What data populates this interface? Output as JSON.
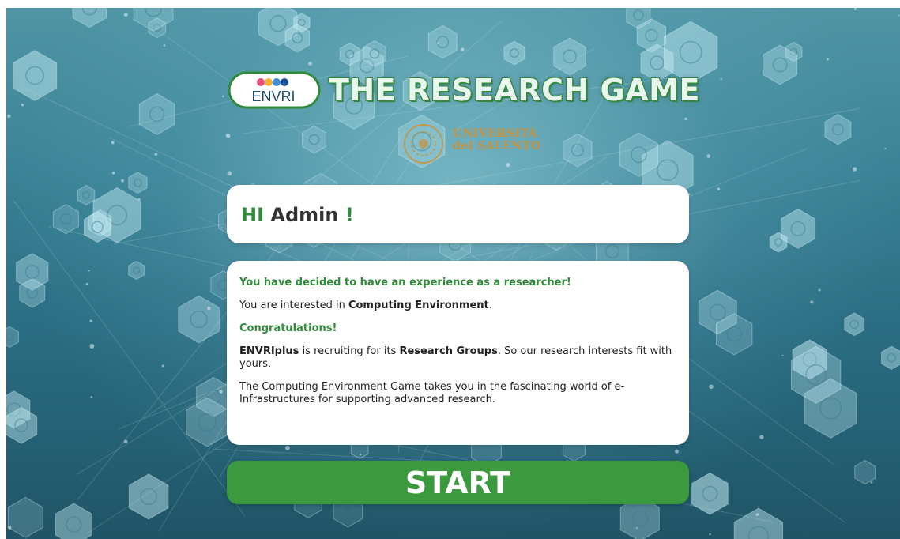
{
  "header": {
    "logo_text": "ENVRI",
    "title": "THE RESEARCH GAME"
  },
  "university": {
    "name_line1": "UNIVERSITÀ",
    "name_line2": "del SALENTO"
  },
  "greeting": {
    "hi": "HI",
    "name": "Admin",
    "exclaim": "!"
  },
  "message": {
    "line1": "You have decided to have an experience as a researcher!",
    "line2_prefix": "You are interested in ",
    "line2_topic": "Computing Environment",
    "line2_suffix": ".",
    "line3": "Congratulations!",
    "line4_org": "ENVRIplus",
    "line4_mid": " is recruiting for its ",
    "line4_groups": "Research Groups",
    "line4_suffix": ". So our research interests fit with yours.",
    "line5": "The Computing Environment Game takes you in the fascinating world of e-Infrastructures for supporting advanced research."
  },
  "start_button": {
    "label": "START"
  },
  "colors": {
    "accent_green": "#2f8a3a",
    "button_green": "#3c9a3e",
    "university_gold": "#c9913a"
  },
  "icons": [
    "microscope-icon",
    "dna-icon",
    "molecule-icon",
    "lab-experiment-icon"
  ]
}
